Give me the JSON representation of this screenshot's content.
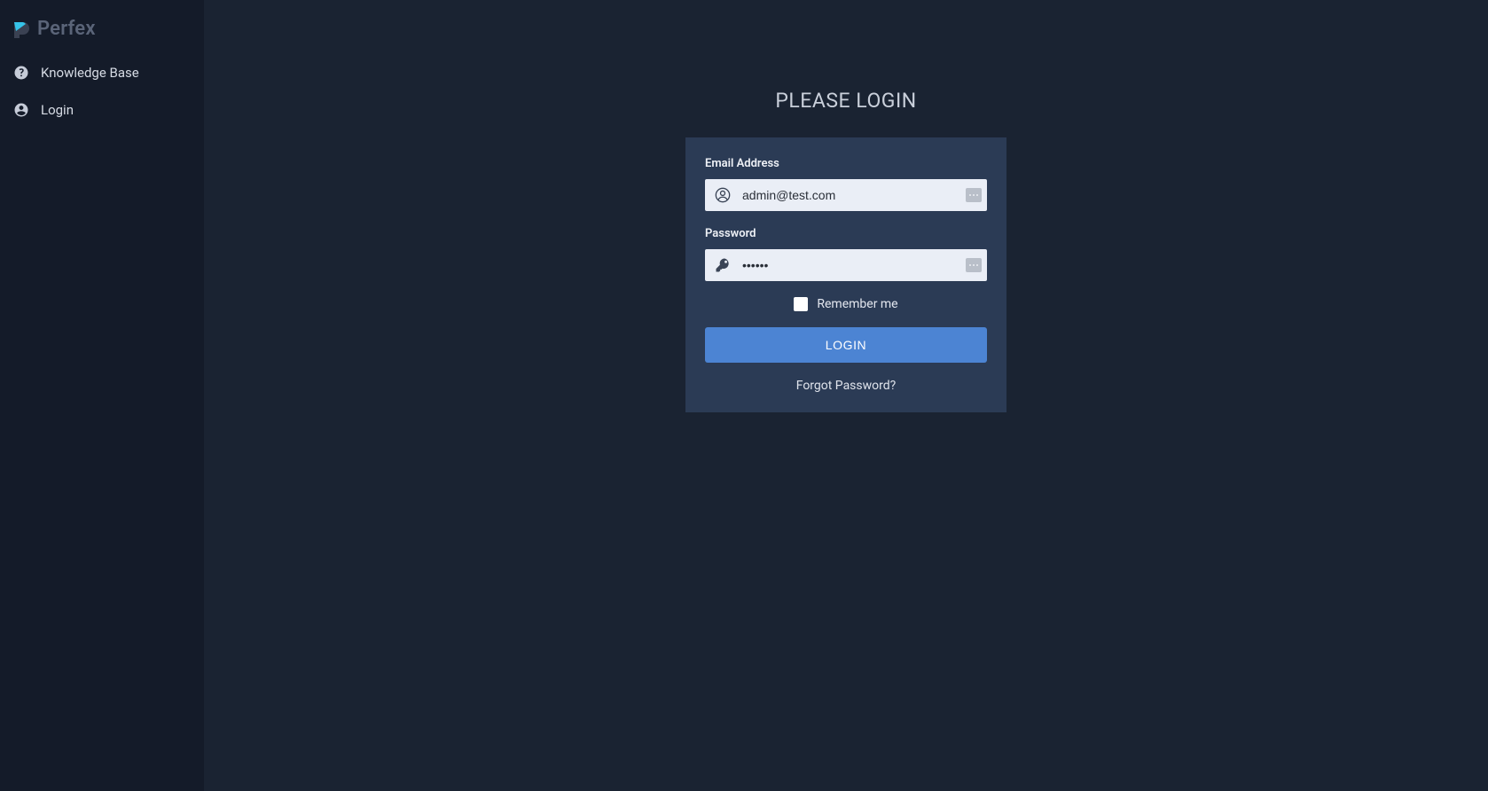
{
  "brand": {
    "name": "Perfex"
  },
  "sidebar": {
    "items": [
      {
        "label": "Knowledge Base"
      },
      {
        "label": "Login"
      }
    ]
  },
  "login": {
    "title": "PLEASE LOGIN",
    "email_label": "Email Address",
    "email_value": "admin@test.com",
    "password_label": "Password",
    "password_value": "••••••",
    "remember_label": "Remember me",
    "submit_label": "LOGIN",
    "forgot_label": "Forgot Password?"
  }
}
